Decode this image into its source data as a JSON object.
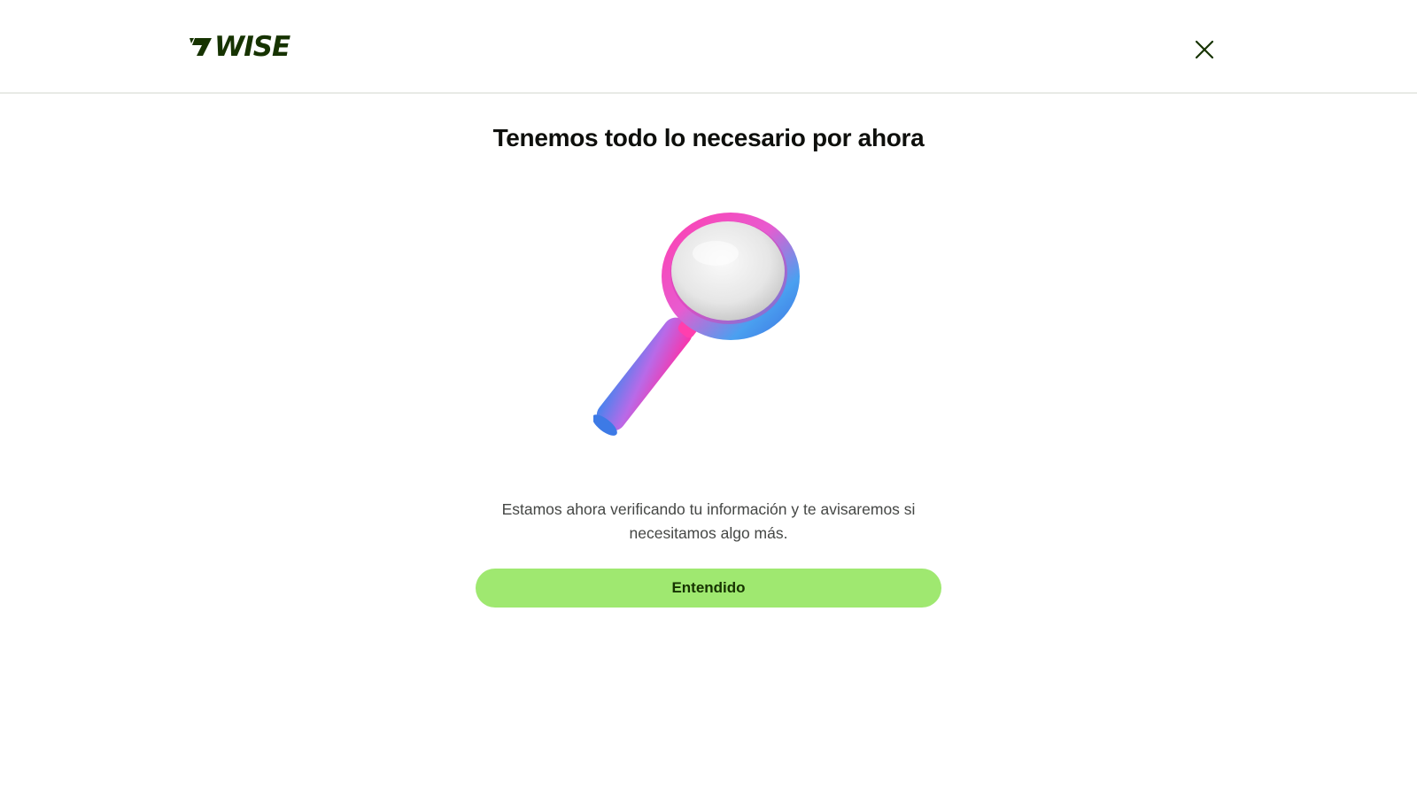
{
  "header": {
    "logo_text": "WISE",
    "logo_icon": "wise-flag-icon",
    "close_icon": "close-icon",
    "brand_color": "#163300"
  },
  "main": {
    "title": "Tenemos todo lo necesario por ahora",
    "illustration": "magnifying-glass-icon",
    "message": "Estamos ahora verificando tu información y te avisaremos si necesitamos algo más.",
    "primary_button_label": "Entendido",
    "button_color": "#9fe870"
  }
}
